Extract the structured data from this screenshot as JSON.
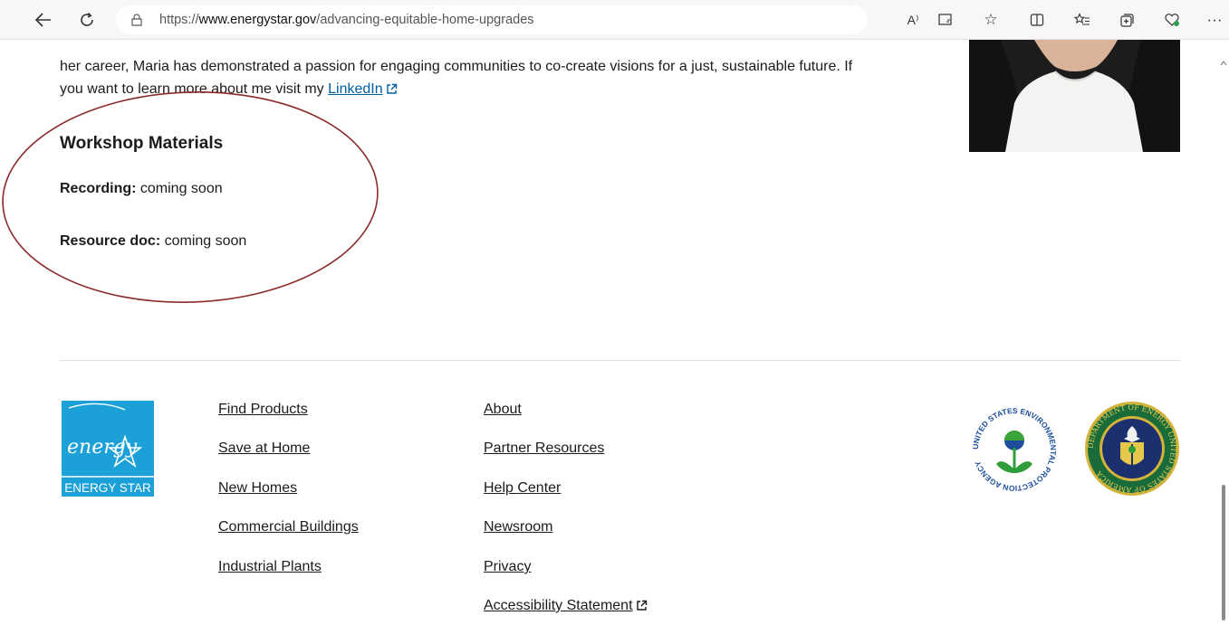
{
  "browser": {
    "url_prefix": "https://",
    "url_host": "www.energystar.gov",
    "url_path": "/advancing-equitable-home-upgrades",
    "read_aloud_label": "A⁾"
  },
  "bio": {
    "line1": "her career, Maria has demonstrated a passion for engaging communities to co-create visions for a just, sustainable future. If",
    "line2_prefix": "you want to learn more about me visit my ",
    "link_label": "LinkedIn"
  },
  "workshop": {
    "title": "Workshop Materials",
    "recording_label": "Recording:",
    "recording_value": " coming soon",
    "resource_label": "Resource doc:",
    "resource_value": " coming soon"
  },
  "footer": {
    "logo_text": "ENERGY STAR",
    "logo_script": "energy",
    "col1": [
      "Find Products",
      "Save at Home",
      "New Homes",
      "Commercial Buildings",
      "Industrial Plants"
    ],
    "col2": [
      "About",
      "Partner Resources",
      "Help Center",
      "Newsroom",
      "Privacy",
      "Accessibility Statement"
    ],
    "epa_seal_text": "UNITED STATES ENVIRONMENTAL PROTECTION AGENCY",
    "doe_seal_text": "DEPARTMENT OF ENERGY UNITED STATES OF AMERICA"
  },
  "colors": {
    "link_blue": "#005ea2",
    "energy_star_blue": "#1ba0d8",
    "annotation_red": "#8b2a2a"
  }
}
